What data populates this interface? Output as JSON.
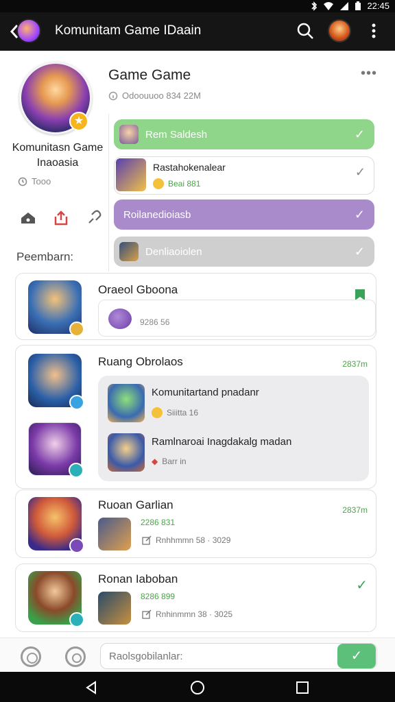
{
  "status_bar": {
    "time": "22:45"
  },
  "app_bar": {
    "title": "Komunitam Game IDaain"
  },
  "profile": {
    "name": "Komunitasn Game Inaoasia",
    "meta": "Tooo",
    "section_label": "Peembarn:"
  },
  "group": {
    "title": "Game Game",
    "subtitle": "Odoouuoo 834 22M",
    "items": [
      {
        "label": "Rem Saldesh"
      },
      {
        "title": "Rastahokenalear",
        "sub": "Beai 881"
      },
      {
        "label": "Roilanedioiasb"
      },
      {
        "label": "Denliaoiolen"
      }
    ]
  },
  "posts": [
    {
      "title": "Oraeol Gboona",
      "count": "9286 56"
    },
    {
      "title": "Ruang Obrolaos",
      "time": "2837m",
      "replies": [
        {
          "title": "Komunitartand pnadanr",
          "sub": "Siiitta 16"
        },
        {
          "title": "Ramlnaroai Inagdakalg madan",
          "sub": "Barr in"
        }
      ]
    },
    {
      "title": "Ruoan Garlian",
      "time": "2837m",
      "num": "2286 831",
      "meta": "Rnhhmmn 58 · 3029"
    },
    {
      "title": "Ronan Iaboban",
      "num": "8286 899",
      "meta": "Rnhinmmn 38 · 3025"
    }
  ],
  "composer": {
    "placeholder": "Raolsgobilanlar:"
  },
  "colors": {
    "accent_green": "#8fd58a",
    "accent_purple": "#a98acb",
    "muted_gray": "#cfcfcf",
    "time_green": "#4ca34a"
  }
}
